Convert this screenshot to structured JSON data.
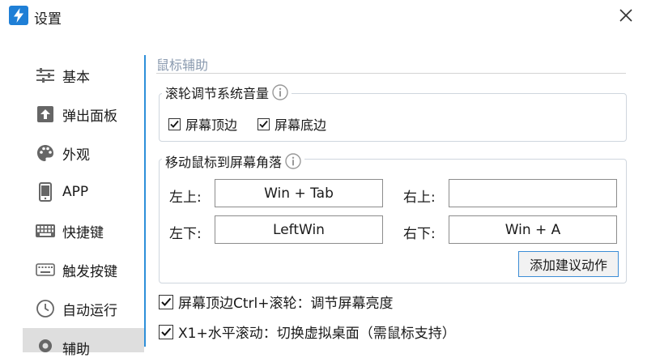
{
  "window": {
    "title": "设置"
  },
  "sidebar": {
    "items": [
      {
        "label": "基本",
        "icon": "sliders-icon"
      },
      {
        "label": "弹出面板",
        "icon": "upload-arrow-icon"
      },
      {
        "label": "外观",
        "icon": "palette-icon"
      },
      {
        "label": "APP",
        "icon": "smartphone-icon"
      },
      {
        "label": "快捷键",
        "icon": "keyboard-icon"
      },
      {
        "label": "触发按键",
        "icon": "keyboard-outline-icon"
      },
      {
        "label": "自动运行",
        "icon": "clock-icon"
      },
      {
        "label": "辅助",
        "icon": "gear-icon",
        "active": true
      }
    ],
    "accent_color": "#2d8fd9"
  },
  "main": {
    "section_title": "鼠标辅助",
    "wheel_group": {
      "title": "滚轮调节系统音量",
      "options": [
        {
          "label": "屏幕顶边",
          "checked": true
        },
        {
          "label": "屏幕底边",
          "checked": true
        }
      ]
    },
    "corner_group": {
      "title": "移动鼠标到屏幕角落",
      "corners": {
        "top_left": {
          "label": "左上:",
          "value": "Win + Tab"
        },
        "top_right": {
          "label": "右上:",
          "value": ""
        },
        "bottom_left": {
          "label": "左下:",
          "value": "LeftWin"
        },
        "bottom_right": {
          "label": "右下:",
          "value": "Win + A"
        }
      },
      "suggest_button": "添加建议动作"
    },
    "extra_options": [
      {
        "label": "屏幕顶边Ctrl+滚轮：调节屏幕亮度",
        "checked": true
      },
      {
        "label": "X1+水平滚动：切换虚拟桌面（需鼠标支持）",
        "checked": true
      }
    ]
  }
}
